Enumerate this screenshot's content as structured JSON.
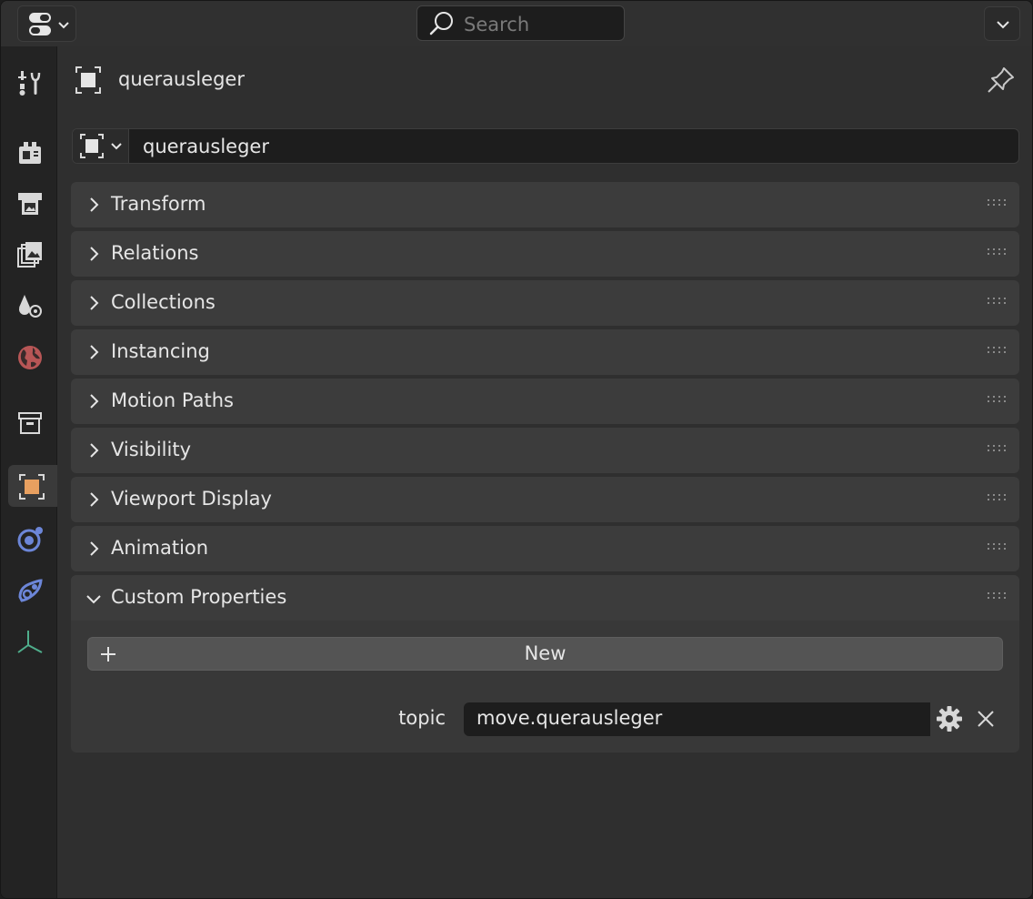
{
  "header": {
    "search_placeholder": "Search"
  },
  "tabs": [
    {
      "name": "tool",
      "icon": "tool-icon"
    },
    {
      "name": "render",
      "icon": "render-icon"
    },
    {
      "name": "output",
      "icon": "output-icon"
    },
    {
      "name": "view-layer",
      "icon": "view-layer-icon"
    },
    {
      "name": "scene",
      "icon": "scene-icon"
    },
    {
      "name": "world",
      "icon": "world-icon"
    },
    {
      "name": "collection",
      "icon": "collection-icon"
    },
    {
      "name": "object",
      "icon": "object-icon",
      "active": true
    },
    {
      "name": "physics",
      "icon": "physics-icon"
    },
    {
      "name": "constraints",
      "icon": "constraints-icon"
    },
    {
      "name": "data",
      "icon": "empty-axes-icon"
    }
  ],
  "context": {
    "object_name": "querausleger"
  },
  "name_field": {
    "value": "querausleger"
  },
  "panels": [
    {
      "label": "Transform",
      "open": false
    },
    {
      "label": "Relations",
      "open": false
    },
    {
      "label": "Collections",
      "open": false
    },
    {
      "label": "Instancing",
      "open": false
    },
    {
      "label": "Motion Paths",
      "open": false
    },
    {
      "label": "Visibility",
      "open": false
    },
    {
      "label": "Viewport Display",
      "open": false
    },
    {
      "label": "Animation",
      "open": false
    },
    {
      "label": "Custom Properties",
      "open": true
    }
  ],
  "custom_properties": {
    "new_label": "New",
    "props": [
      {
        "key": "topic",
        "value": "move.querausleger"
      }
    ]
  },
  "colors": {
    "active_tab_accent": "#e8a060",
    "world_icon": "#b85656",
    "physics_icon": "#6c86d8",
    "axes_icon": "#4fae8c"
  }
}
